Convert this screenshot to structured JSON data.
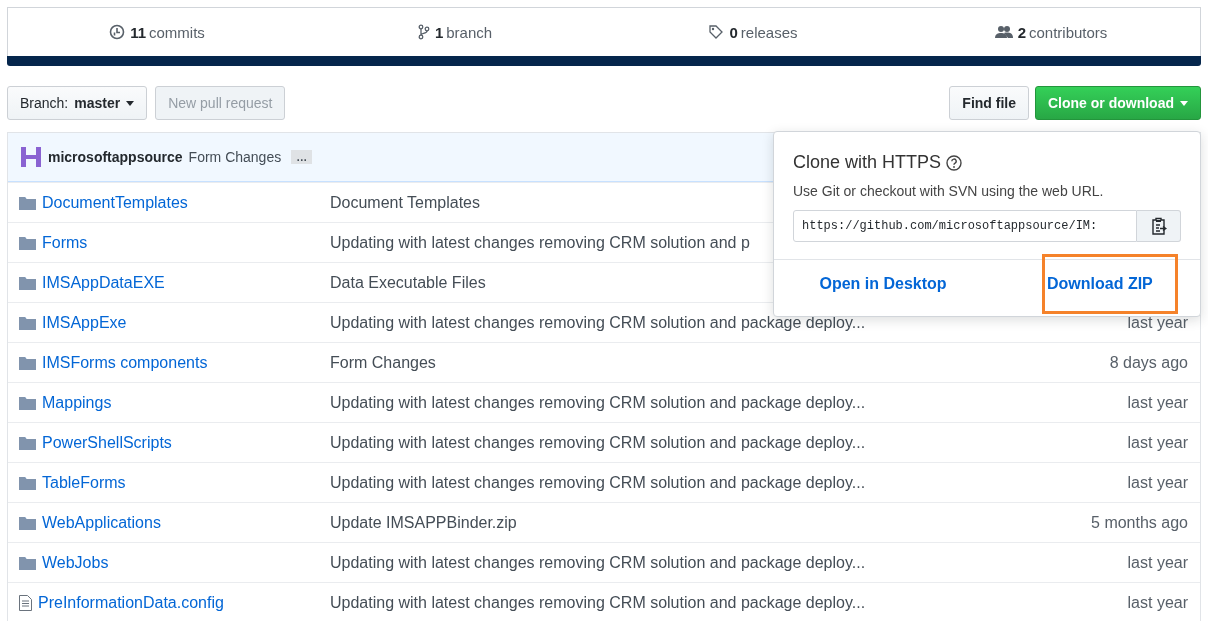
{
  "stats": [
    {
      "kind": "commits",
      "count": "11",
      "label": "commits"
    },
    {
      "kind": "branch",
      "count": "1",
      "label": "branch"
    },
    {
      "kind": "releases",
      "count": "0",
      "label": "releases"
    },
    {
      "kind": "contributors",
      "count": "2",
      "label": "contributors"
    }
  ],
  "toolbar": {
    "branch_label": "Branch:",
    "branch": "master",
    "new_pull_request": {
      "label": "New pull request",
      "disabled": true
    },
    "find_file": "Find file",
    "clone_button": "Clone or download"
  },
  "commit": {
    "author": "microsoftappsource",
    "message": "Form Changes",
    "more": "…"
  },
  "files": [
    {
      "kind": "folder",
      "name": "DocumentTemplates",
      "message": "Document Templates"
    },
    {
      "kind": "folder",
      "name": "Forms",
      "message": "Updating with latest changes removing CRM solution and p"
    },
    {
      "kind": "folder",
      "name": "IMSAppDataEXE",
      "message": "Data Executable Files"
    },
    {
      "kind": "folder",
      "name": "IMSAppExe",
      "message": "Updating with latest changes removing CRM solution and package deploy...",
      "age": "last year"
    },
    {
      "kind": "folder",
      "name": "IMSForms components",
      "message": "Form Changes",
      "age": "8 days ago"
    },
    {
      "kind": "folder",
      "name": "Mappings",
      "message": "Updating with latest changes removing CRM solution and package deploy...",
      "age": "last year"
    },
    {
      "kind": "folder",
      "name": "PowerShellScripts",
      "message": "Updating with latest changes removing CRM solution and package deploy...",
      "age": "last year"
    },
    {
      "kind": "folder",
      "name": "TableForms",
      "message": "Updating with latest changes removing CRM solution and package deploy...",
      "age": "last year"
    },
    {
      "kind": "folder",
      "name": "WebApplications",
      "message": "Update IMSAPPBinder.zip",
      "age": "5 months ago"
    },
    {
      "kind": "folder",
      "name": "WebJobs",
      "message": "Updating with latest changes removing CRM solution and package deploy...",
      "age": "last year"
    },
    {
      "kind": "file",
      "name": "PreInformationData.config",
      "message": "Updating with latest changes removing CRM solution and package deploy...",
      "age": "last year"
    }
  ],
  "clone_popup": {
    "title": "Clone with HTTPS",
    "description": "Use Git or checkout with SVN using the web URL.",
    "url": "https://github.com/microsoftappsource/IM:",
    "actions": [
      {
        "label": "Open in Desktop",
        "highlighted": false
      },
      {
        "label": "Download ZIP",
        "highlighted": true
      }
    ]
  }
}
